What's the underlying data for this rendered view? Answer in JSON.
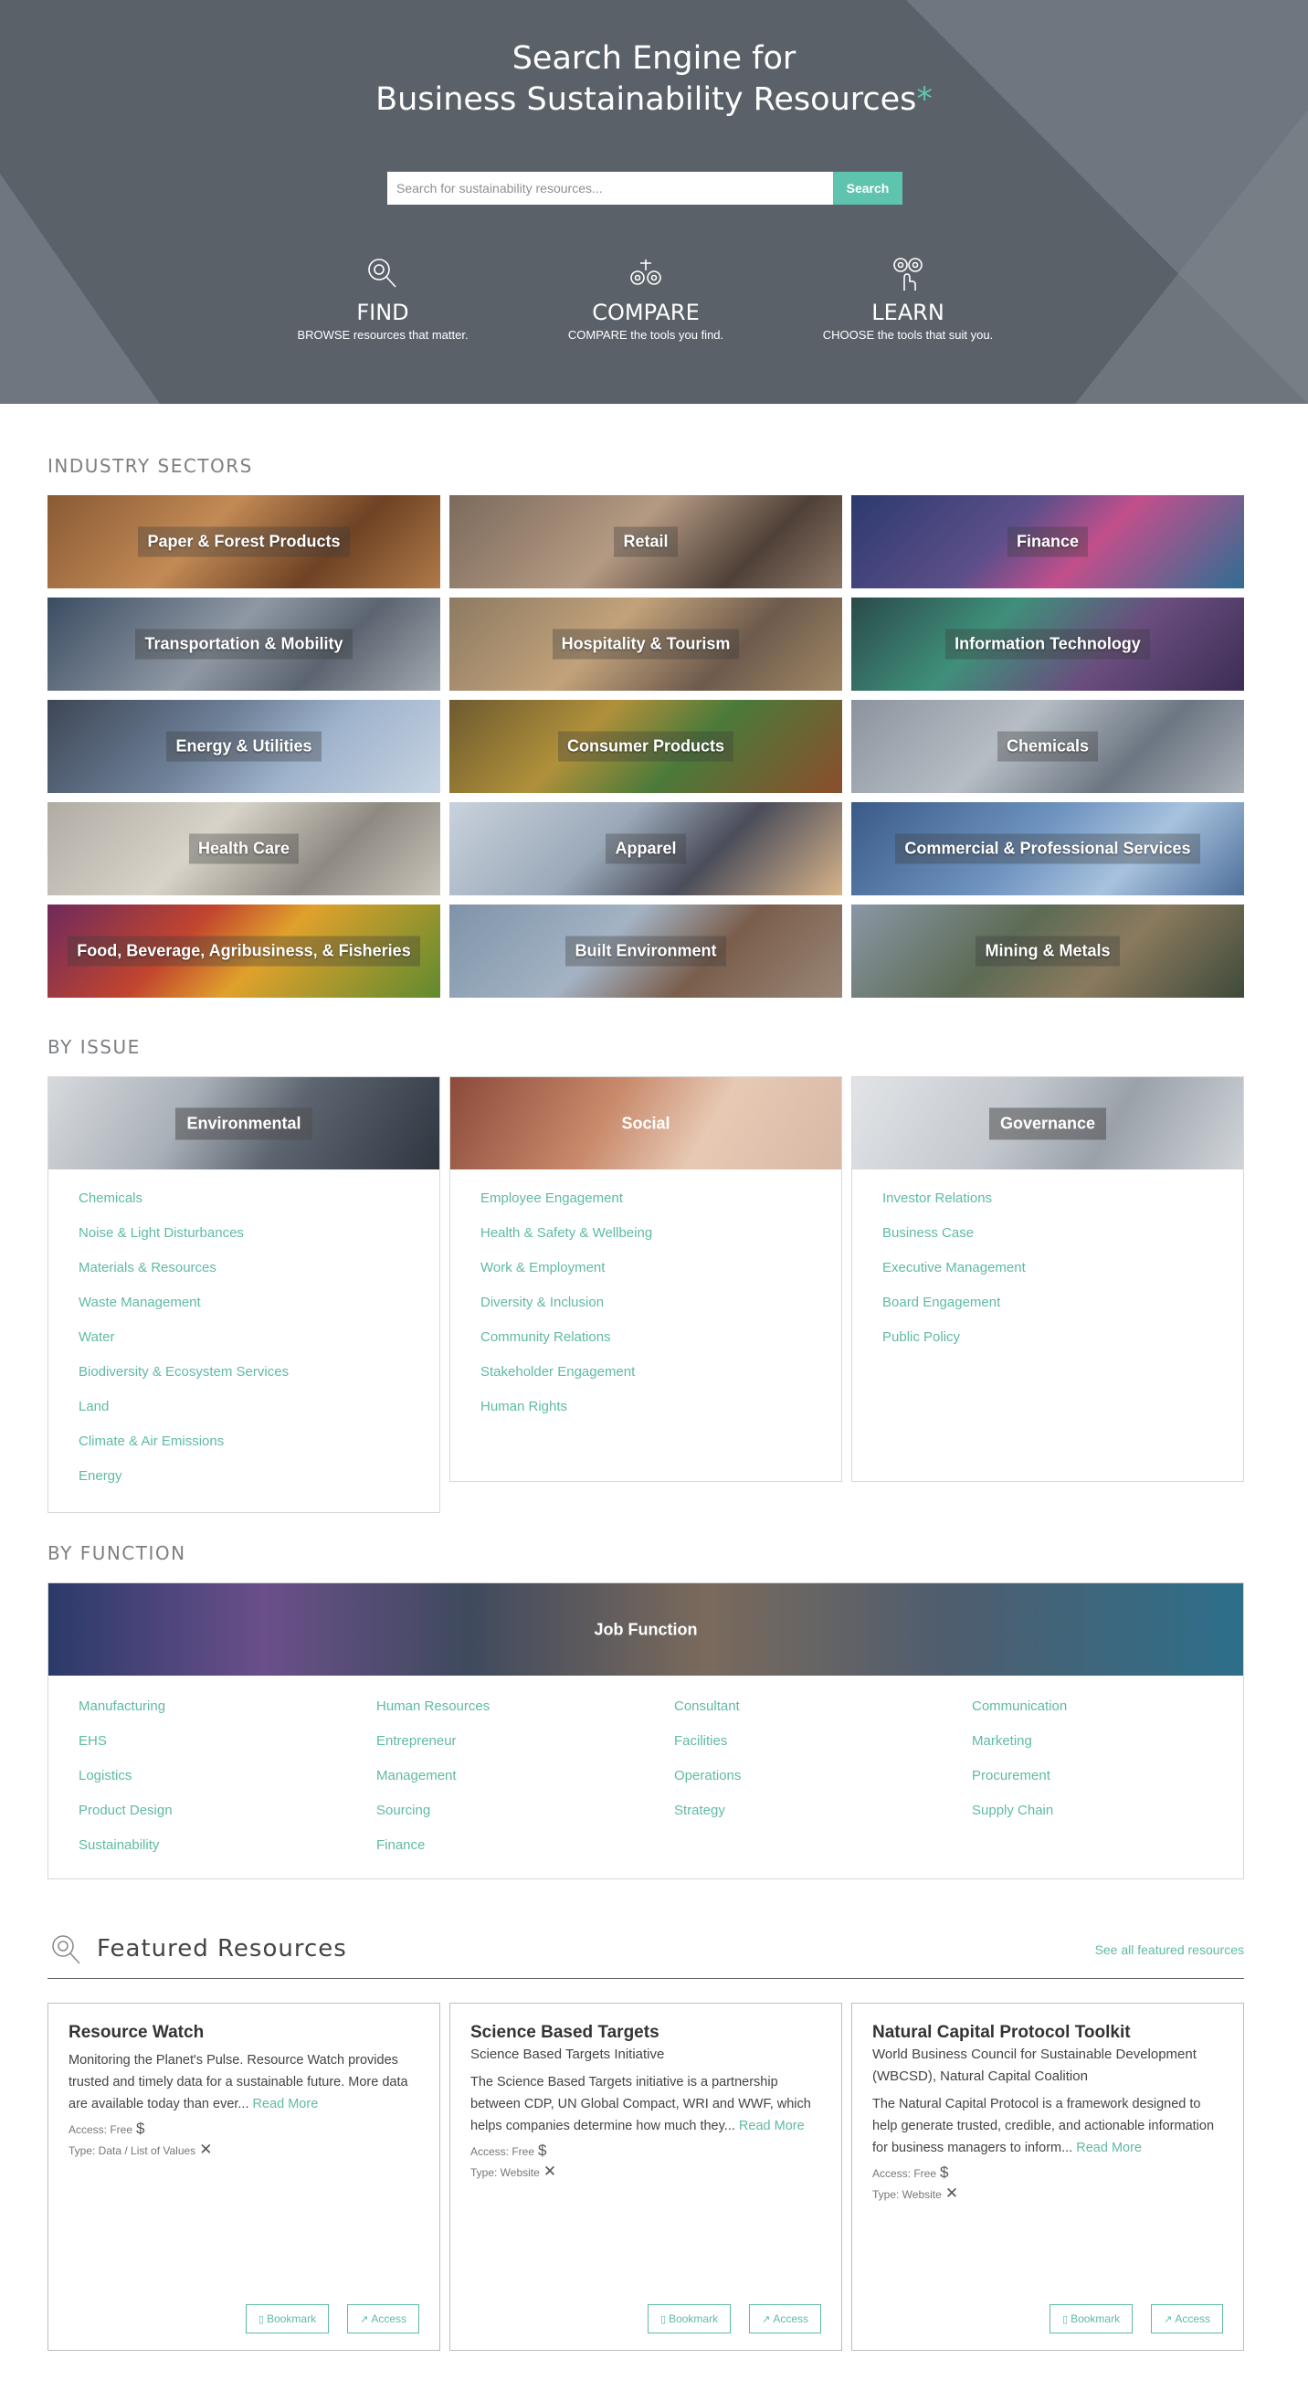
{
  "hero": {
    "title_line1": "Search Engine for",
    "title_line2": "Business Sustainability Resources",
    "title_mark": "*",
    "search_placeholder": "Search for sustainability resources...",
    "search_button": "Search",
    "pillars": [
      {
        "head": "FIND",
        "sub": "BROWSE resources that matter.",
        "icon": "magnifier-icon"
      },
      {
        "head": "COMPARE",
        "sub": "COMPARE the tools you find.",
        "icon": "compare-icon"
      },
      {
        "head": "LEARN",
        "sub": "CHOOSE the tools that suit you.",
        "icon": "choose-icon"
      }
    ]
  },
  "sectors": {
    "heading": "INDUSTRY SECTORS",
    "tiles": [
      "Paper & Forest Products",
      "Retail",
      "Finance",
      "Transportation & Mobility",
      "Hospitality & Tourism",
      "Information Technology",
      "Energy & Utilities",
      "Consumer Products",
      "Chemicals",
      "Health Care",
      "Apparel",
      "Commercial & Professional Services",
      "Food, Beverage, Agribusiness, & Fisheries",
      "Built Environment",
      "Mining & Metals"
    ]
  },
  "issues": {
    "heading": "BY ISSUE",
    "cards": [
      {
        "title": "Environmental",
        "items": [
          "Chemicals",
          "Noise & Light Disturbances",
          "Materials & Resources",
          "Waste Management",
          "Water",
          "Biodiversity & Ecosystem Services",
          "Land",
          "Climate & Air Emissions",
          "Energy"
        ]
      },
      {
        "title": "Social",
        "items": [
          "Employee Engagement",
          "Health & Safety & Wellbeing",
          "Work & Employment",
          "Diversity & Inclusion",
          "Community Relations",
          "Stakeholder Engagement",
          "Human Rights"
        ]
      },
      {
        "title": "Governance",
        "items": [
          "Investor Relations",
          "Business Case",
          "Executive Management",
          "Board Engagement",
          "Public Policy"
        ]
      }
    ]
  },
  "functions": {
    "heading": "BY FUNCTION",
    "title": "Job Function",
    "columns": [
      [
        "Manufacturing",
        "EHS",
        "Logistics",
        "Product Design",
        "Sustainability"
      ],
      [
        "Human Resources",
        "Entrepreneur",
        "Management",
        "Sourcing",
        "Finance"
      ],
      [
        "Consultant",
        "Facilities",
        "Operations",
        "Strategy"
      ],
      [
        "Communication",
        "Marketing",
        "Procurement",
        "Supply Chain"
      ]
    ]
  },
  "featured": {
    "title": "Featured Resources",
    "see_all": "See all featured resources",
    "bookmark_label": "Bookmark",
    "access_label": "Access",
    "cards": [
      {
        "title": "Resource Watch",
        "org": "",
        "desc": "Monitoring the Planet's Pulse. Resource Watch provides trusted and timely data for a sustainable future. More data are available today than ever...",
        "read_more": "Read More",
        "access": "Access: Free",
        "type": "Type: Data / List of Values"
      },
      {
        "title": "Science Based Targets",
        "org": "Science Based Targets Initiative",
        "desc": "The Science Based Targets initiative is a partnership between CDP, UN Global Compact, WRI and WWF, which helps companies determine how much they...",
        "read_more": "Read More",
        "access": "Access: Free",
        "type": "Type: Website"
      },
      {
        "title": "Natural Capital Protocol Toolkit",
        "org": "World Business Council for Sustainable Development (WBCSD), Natural Capital Coalition",
        "desc": "The Natural Capital Protocol is a framework designed to help generate trusted, credible, and actionable information for business managers to inform...",
        "read_more": "Read More",
        "access": "Access: Free",
        "type": "Type: Website"
      }
    ]
  },
  "colors": {
    "accent": "#5fc4ad",
    "link": "#5fbaa4",
    "hero_bg": "#5a6169"
  }
}
